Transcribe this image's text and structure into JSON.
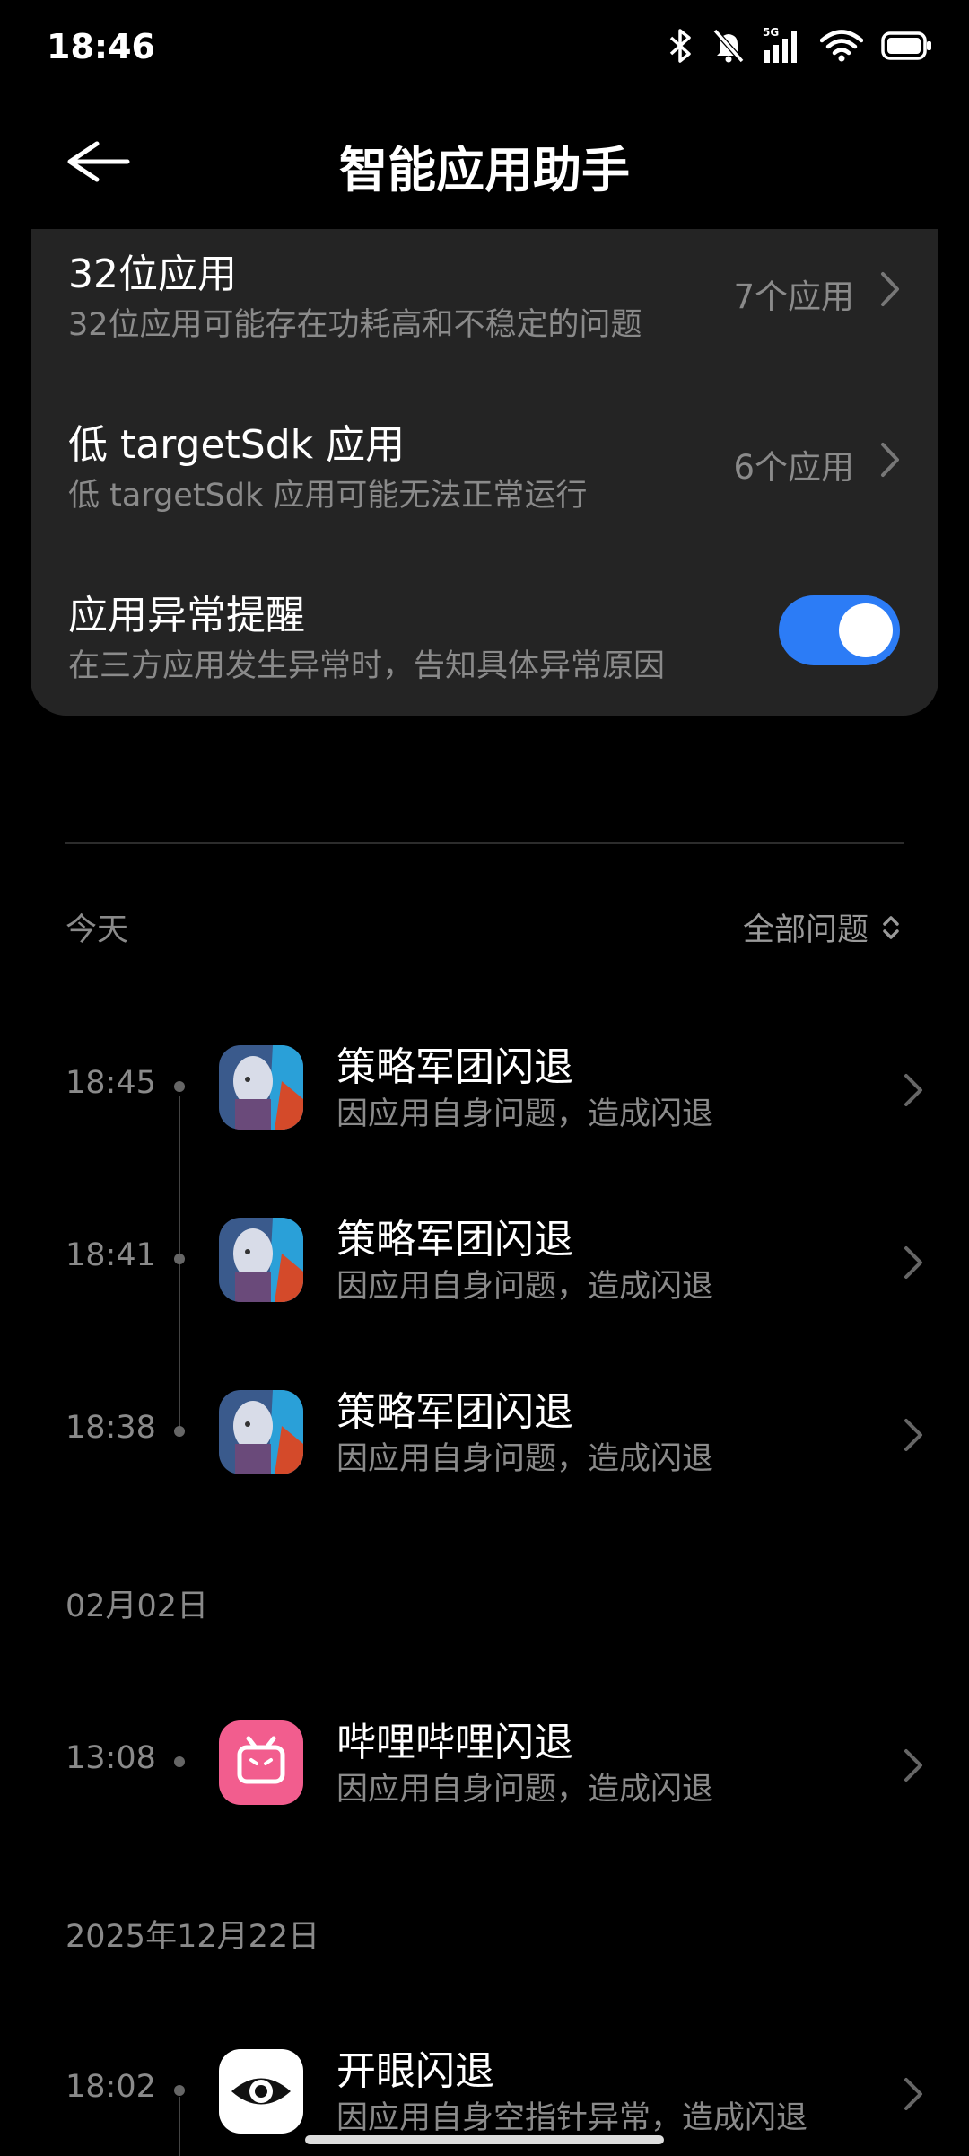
{
  "status_bar": {
    "time": "18:46",
    "network": "5G",
    "icons": [
      "bluetooth-icon",
      "mute-icon",
      "signal-icon",
      "wifi-icon",
      "battery-icon"
    ]
  },
  "header": {
    "title": "智能应用助手",
    "back_icon": "arrow-left-icon"
  },
  "settings": {
    "app32": {
      "title": "32位应用",
      "subtitle": "32位应用可能存在功耗高和不稳定的问题",
      "value": "7个应用"
    },
    "low_sdk": {
      "title": "低 targetSdk 应用",
      "subtitle": "低 targetSdk 应用可能无法正常运行",
      "value": "6个应用"
    },
    "alert": {
      "title": "应用异常提醒",
      "subtitle": "在三方应用发生异常时，告知具体异常原因",
      "enabled": true
    }
  },
  "filter": {
    "section_today": "今天",
    "label": "全部问题"
  },
  "groups": {
    "today": [
      {
        "time": "18:45",
        "title": "策略军团闪退",
        "desc": "因应用自身问题，造成闪退"
      },
      {
        "time": "18:41",
        "title": "策略军团闪退",
        "desc": "因应用自身问题，造成闪退"
      },
      {
        "time": "18:38",
        "title": "策略军团闪退",
        "desc": "因应用自身问题，造成闪退"
      }
    ],
    "feb02_label": "02月02日",
    "feb02": [
      {
        "time": "13:08",
        "title": "哔哩哔哩闪退",
        "desc": "因应用自身问题，造成闪退"
      }
    ],
    "dec22_label": "2025年12月22日",
    "dec22": [
      {
        "time": "18:02",
        "title": "开眼闪退",
        "desc": "因应用自身空指针异常，造成闪退"
      }
    ]
  },
  "colors": {
    "accent": "#2c7cf6",
    "card": "#242424",
    "background": "#000000",
    "bilibili": "#f25d8e"
  }
}
